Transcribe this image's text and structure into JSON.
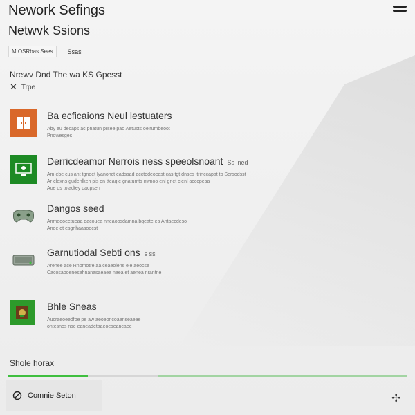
{
  "header": {
    "app_title": "Nework Sefings",
    "page_subtitle": "Netwvk Ssions"
  },
  "breadcrumb": {
    "tabs": [
      {
        "label": "M OSRbas Sees"
      },
      {
        "label": "Ssas"
      }
    ]
  },
  "section": {
    "title": "Nrewv Dnd The wa KS Gpesst",
    "types_label": "Trpe"
  },
  "items": [
    {
      "title": "Ba ecficaions Neul lestuaters",
      "tag": "",
      "desc_lines": [
        "Aby eu decaps ac pnatun prsee pao Aetusts oelrumbeoot",
        "Pnowesges"
      ],
      "icon": "door-icon",
      "thumb_color": "#d9682a"
    },
    {
      "title": "Derricdeamor Nerrois ness speeolsnoant",
      "tag": "Ss ined",
      "desc_lines": [
        "Am ebe cus ant tgnoet lyanonct eadssad acctodeocast cas tgt dnses ltrinccapat to Sersodsst",
        "Ar elexns gudenlkeh pis on tteaqie gnatumts nwnoo enl gnet clenl acccpeaa",
        "Aoe os toiadtey dacpsen"
      ],
      "icon": "monitor-icon",
      "thumb_color": "#1d8a24"
    },
    {
      "title": "Dangos seed",
      "tag": "",
      "desc_lines": [
        "Anmeooeetueaa dacouea nneaoosdamna bqeate ea Antaecdeso",
        "Anee ot esgnhaasoocst"
      ],
      "icon": "gamepad-icon",
      "thumb_color": ""
    },
    {
      "title": "Garnutiodal Sebti ons",
      "tag": "s ss",
      "desc_lines": [
        "Arenee ace Rnomotre aa ceaeoiens ele aeocse",
        "Cacosaooenesehnanasaeaea naea et aenea nrantne"
      ],
      "icon": "console-icon",
      "thumb_color": ""
    },
    {
      "title": "Bhle Sneas",
      "tag": "",
      "desc_lines": [
        "Aucraeoeedfoe pe aw aeoeoncoaenseaeae",
        "ontesnos nse eaneadetaaeoeseancaee"
      ],
      "icon": "game-box-icon",
      "thumb_color": "#2d9a2b"
    }
  ],
  "footer": {
    "status_label": "Shole horax",
    "progress_fraction": 0.2,
    "connect_label": "Comnie Seton",
    "colors": {
      "accent": "#3fbf3f"
    }
  }
}
